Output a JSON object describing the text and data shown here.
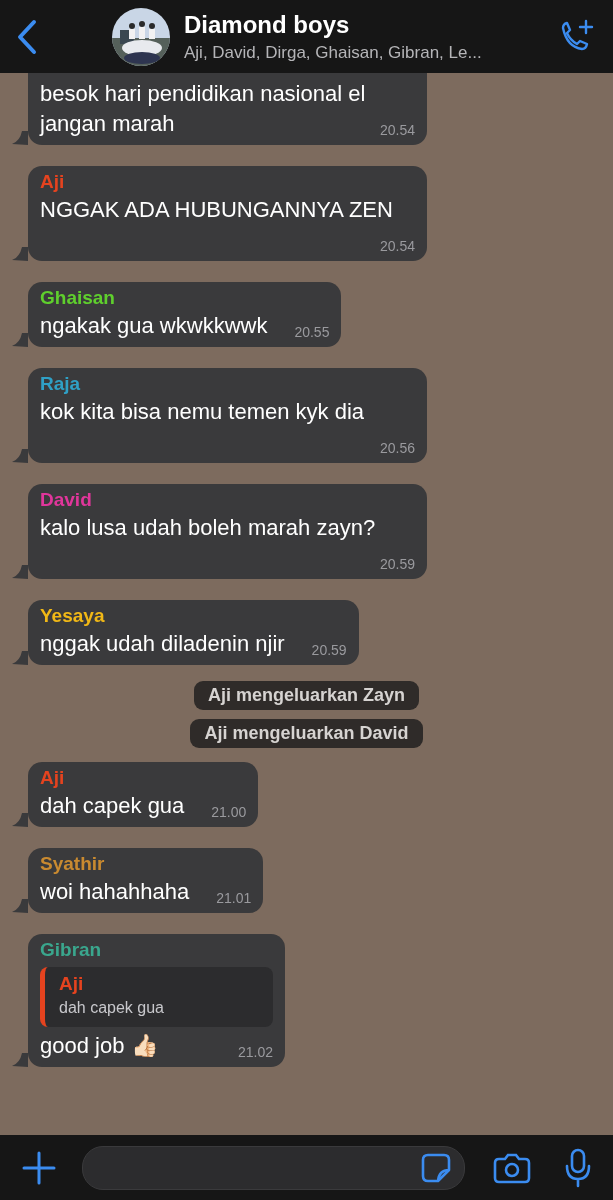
{
  "header": {
    "title": "Diamond boys",
    "subtitle": "Aji, David, Dirga, Ghaisan, Gibran, Le..."
  },
  "messages": [
    {
      "kind": "message",
      "text": "besok hari pendidikan nasional el jangan marah",
      "time": "20.54"
    },
    {
      "kind": "message",
      "sender": "Aji",
      "color": "#e5431f",
      "text": "NGGAK ADA HUBUNGANNYA ZEN",
      "time": "20.54"
    },
    {
      "kind": "message",
      "sender": "Ghaisan",
      "color": "#5fcf2d",
      "text": "ngakak gua wkwkkwwk",
      "time": "20.55"
    },
    {
      "kind": "message",
      "sender": "Raja",
      "color": "#2fa0c6",
      "text": "kok kita bisa nemu temen kyk dia",
      "time": "20.56"
    },
    {
      "kind": "message",
      "sender": "David",
      "color": "#e0369b",
      "text": "kalo lusa udah boleh marah zayn?",
      "time": "20.59"
    },
    {
      "kind": "message",
      "sender": "Yesaya",
      "color": "#f1b816",
      "text": "nggak udah diladenin njir",
      "time": "20.59"
    },
    {
      "kind": "system",
      "text": "Aji mengeluarkan Zayn"
    },
    {
      "kind": "system",
      "text": "Aji mengeluarkan David"
    },
    {
      "kind": "message",
      "sender": "Aji",
      "color": "#e5431f",
      "text": "dah capek gua",
      "time": "21.00"
    },
    {
      "kind": "message",
      "sender": "Syathir",
      "color": "#c98a30",
      "text": "woi hahahhaha",
      "time": "21.01"
    },
    {
      "kind": "message",
      "sender": "Gibran",
      "color": "#3aa68d",
      "reply": {
        "sender": "Aji",
        "color": "#e5431f",
        "text": "dah capek gua"
      },
      "text": "good job 👍🏻",
      "time": "21.02"
    }
  ]
}
